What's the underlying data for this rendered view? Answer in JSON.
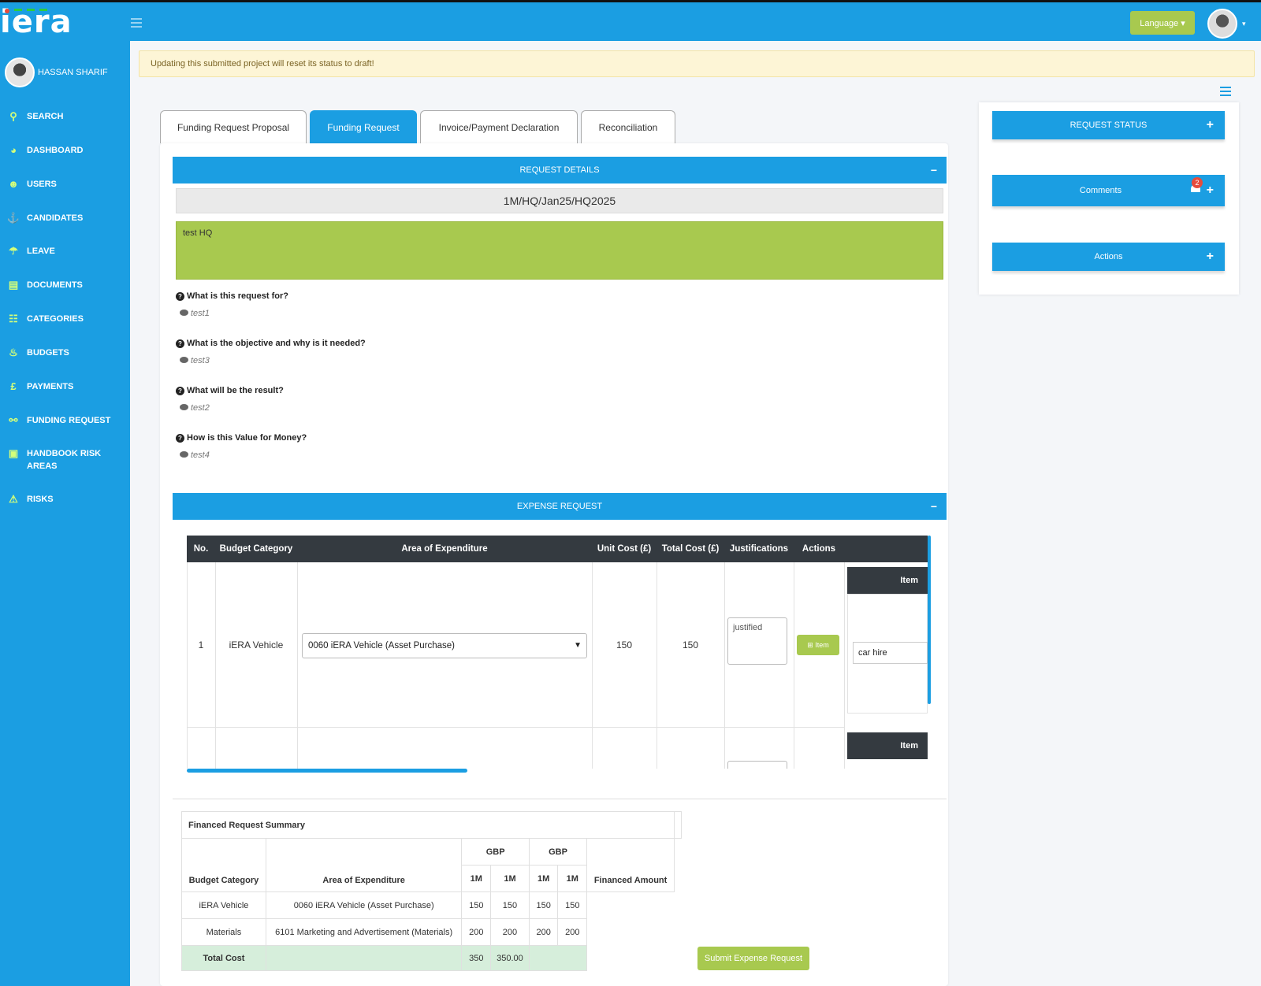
{
  "brand": {
    "logo_text": "iera"
  },
  "header": {
    "language_label": "Language ▾"
  },
  "user": {
    "name": "HASSAN SHARIF"
  },
  "sidebar": {
    "items": [
      {
        "label": "SEARCH",
        "icon": "search-icon"
      },
      {
        "label": "DASHBOARD",
        "icon": "dashboard-icon"
      },
      {
        "label": "USERS",
        "icon": "users-icon"
      },
      {
        "label": "CANDIDATES",
        "icon": "candidates-icon"
      },
      {
        "label": "LEAVE",
        "icon": "leave-icon"
      },
      {
        "label": "DOCUMENTS",
        "icon": "documents-icon"
      },
      {
        "label": "CATEGORIES",
        "icon": "categories-icon"
      },
      {
        "label": "BUDGETS",
        "icon": "budgets-icon"
      },
      {
        "label": "PAYMENTS",
        "icon": "pound-icon"
      },
      {
        "label": "FUNDING REQUEST",
        "icon": "funding-icon"
      },
      {
        "label": "HANDBOOK RISK AREAS",
        "icon": "handbook-icon"
      },
      {
        "label": "RISKS",
        "icon": "warning-icon"
      }
    ]
  },
  "alert": {
    "text": "Updating this submitted project will reset its status to draft!"
  },
  "tabs": [
    {
      "label": "Funding Request Proposal",
      "active": false
    },
    {
      "label": "Funding Request",
      "active": true
    },
    {
      "label": "Invoice/Payment Declaration",
      "active": false
    },
    {
      "label": "Reconciliation",
      "active": false
    }
  ],
  "request_details": {
    "title": "REQUEST DETAILS",
    "collapse": "−",
    "reference": "1M/HQ/Jan25/HQ2025",
    "description": "test HQ",
    "questions": [
      {
        "q": "What is this request for?",
        "a": "test1"
      },
      {
        "q": "What is the objective and why is it needed?",
        "a": "test3"
      },
      {
        "q": "What will be the result?",
        "a": "test2"
      },
      {
        "q": "How is this Value for Money?",
        "a": "test4"
      }
    ]
  },
  "expense": {
    "title": "EXPENSE REQUEST",
    "collapse": "−",
    "headers": {
      "no": "No.",
      "category": "Budget Category",
      "area": "Area of Expenditure",
      "unit": "Unit Cost (£)",
      "total": "Total Cost (£)",
      "just": "Justifications",
      "actions": "Actions"
    },
    "rows": [
      {
        "no": "1",
        "category": "iERA Vehicle",
        "area": "0060 iERA Vehicle (Asset Purchase)",
        "unit": "150",
        "total": "150",
        "justification": "justified",
        "action_label": "Item",
        "item_header": "Item",
        "item_value": "car hire"
      }
    ],
    "next_item_header": "Item"
  },
  "summary": {
    "caption": "Financed Request Summary",
    "gbp": "GBP",
    "h_category": "Budget Category",
    "h_area": "Area of Expenditure",
    "h_1m": "1M",
    "h_financed": "Financed Amount",
    "rows": [
      {
        "category": "iERA Vehicle",
        "area": "0060 iERA Vehicle (Asset Purchase)",
        "v": [
          "150",
          "150",
          "150",
          "150"
        ]
      },
      {
        "category": "Materials",
        "area": "6101 Marketing and Advertisement (Materials)",
        "v": [
          "200",
          "200",
          "200",
          "200"
        ]
      }
    ],
    "total_label": "Total Cost",
    "total_a": "350",
    "total_b": "350.00",
    "submit_label": "Submit Expense Request"
  },
  "right": {
    "status": "REQUEST STATUS",
    "comments": "Comments",
    "comments_badge": "2",
    "actions": "Actions",
    "plus": "+"
  }
}
